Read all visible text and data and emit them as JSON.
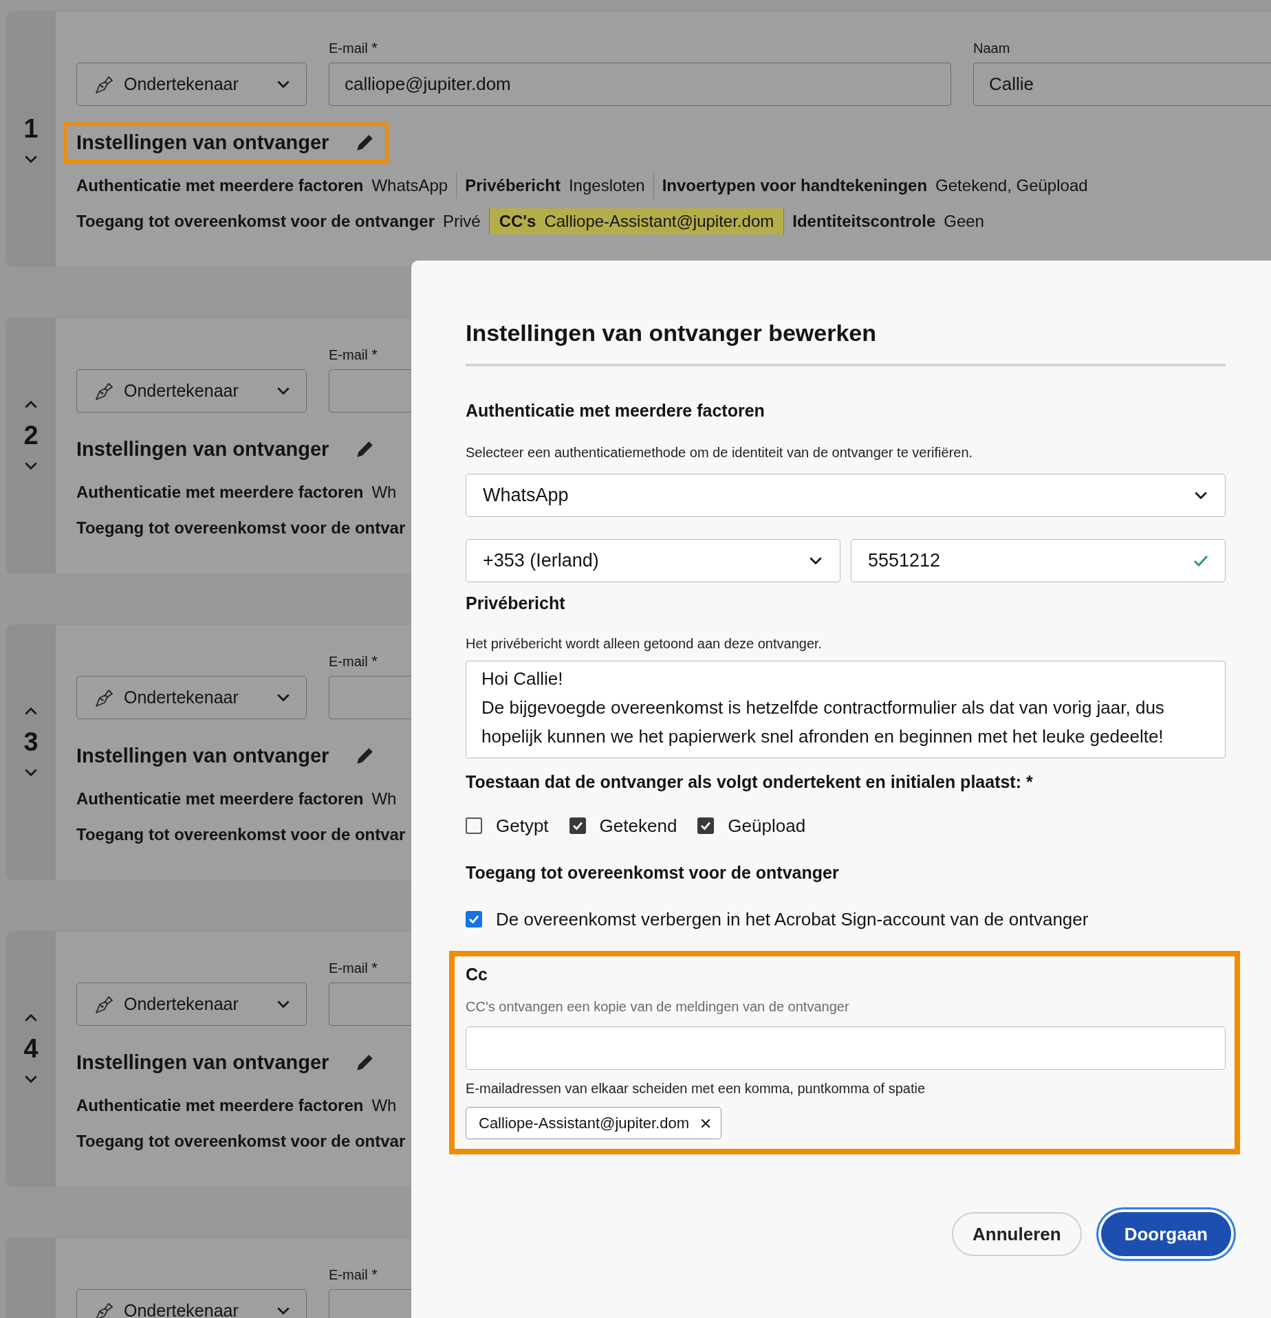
{
  "recipients": [
    {
      "number": "1",
      "move_up": false,
      "move_down": true,
      "role": "Ondertekenaar",
      "email_label": "E-mail",
      "email_required": "*",
      "email": "calliope@jupiter.dom",
      "name_label": "Naam",
      "name": "Callie",
      "settings_title": "Instellingen van ontvanger",
      "settings_callout": true,
      "detail_rows": [
        {
          "items": [
            {
              "label": "Authenticatie met meerdere factoren",
              "value": "WhatsApp",
              "highlighted": false
            },
            {
              "label": "Privébericht",
              "value": "Ingesloten",
              "highlighted": false
            },
            {
              "label": "Invoertypen voor handtekeningen",
              "value": "Getekend, Geüpload",
              "highlighted": false
            }
          ]
        },
        {
          "items": [
            {
              "label": "Toegang tot overeenkomst voor de ontvanger",
              "value": "Privé",
              "highlighted": false
            },
            {
              "label": "CC's",
              "value": "Calliope-Assistant@jupiter.dom",
              "highlighted": true
            },
            {
              "label": "Identiteitscontrole",
              "value": "Geen",
              "highlighted": false
            }
          ]
        }
      ]
    },
    {
      "number": "2",
      "move_up": true,
      "move_down": true,
      "role": "Ondertekenaar",
      "email_label": "E-mail",
      "email_required": "*",
      "settings_title": "Instellingen van ontvanger",
      "settings_callout": false,
      "detail_rows": [
        {
          "items": [
            {
              "label": "Authenticatie met meerdere factoren",
              "value": "Wh",
              "highlighted": false
            }
          ]
        },
        {
          "items": [
            {
              "label": "Toegang tot overeenkomst voor de ontvar",
              "highlighted": false
            }
          ]
        }
      ]
    },
    {
      "number": "3",
      "move_up": true,
      "move_down": true,
      "role": "Ondertekenaar",
      "email_label": "E-mail",
      "email_required": "*",
      "settings_title": "Instellingen van ontvanger",
      "settings_callout": false,
      "detail_rows": [
        {
          "items": [
            {
              "label": "Authenticatie met meerdere factoren",
              "value": "Wh",
              "highlighted": false
            }
          ]
        },
        {
          "items": [
            {
              "label": "Toegang tot overeenkomst voor de ontvar",
              "highlighted": false
            }
          ]
        }
      ]
    },
    {
      "number": "4",
      "move_up": true,
      "move_down": true,
      "role": "Ondertekenaar",
      "email_label": "E-mail",
      "email_required": "*",
      "settings_title": "Instellingen van ontvanger",
      "settings_callout": false,
      "detail_rows": [
        {
          "items": [
            {
              "label": "Authenticatie met meerdere factoren",
              "value": "Wh",
              "highlighted": false
            }
          ]
        },
        {
          "items": [
            {
              "label": "Toegang tot overeenkomst voor de ontvar",
              "highlighted": false
            }
          ]
        }
      ]
    },
    {
      "role": "Ondertekenaar",
      "email_label": "E-mail",
      "email_required": "*"
    }
  ],
  "dialog": {
    "title": "Instellingen van ontvanger bewerken",
    "mfa": {
      "heading": "Authenticatie met meerdere factoren",
      "description": "Selecteer een authenticatiemethode om de identiteit van de ontvanger te verifiëren.",
      "method": "WhatsApp",
      "country_code": "+353 (Ierland)",
      "phone": "5551212",
      "phone_valid": true
    },
    "private_message": {
      "heading": "Privébericht",
      "description": "Het privébericht wordt alleen getoond aan deze ontvanger.",
      "lines": [
        "Hoi Callie!",
        "De bijgevoegde overeenkomst is hetzelfde contractformulier als dat van vorig jaar, dus",
        "hopelijk kunnen we het papierwerk snel afronden en beginnen met het leuke gedeelte!"
      ]
    },
    "signature_types": {
      "heading": "Toestaan dat de ontvanger als volgt ondertekent en initialen plaatst: *",
      "options": [
        {
          "label": "Getypt",
          "checked": false
        },
        {
          "label": "Getekend",
          "checked": true
        },
        {
          "label": "Geüpload",
          "checked": true
        }
      ]
    },
    "access": {
      "heading": "Toegang tot overeenkomst voor de ontvanger",
      "option": {
        "label": "De overeenkomst verbergen in het Acrobat Sign-account van de ontvanger",
        "checked": true
      }
    },
    "cc": {
      "callout": true,
      "heading": "Cc",
      "description": "CC's ontvangen een kopie van de meldingen van de ontvanger",
      "hint": "E-mailadressen van elkaar scheiden met een komma, puntkomma of spatie",
      "recipients": [
        {
          "email": "Calliope-Assistant@jupiter.dom"
        }
      ]
    },
    "buttons": [
      {
        "label": "Annuleren",
        "kind": "secondary"
      },
      {
        "label": "Doorgaan",
        "kind": "primary"
      }
    ]
  }
}
